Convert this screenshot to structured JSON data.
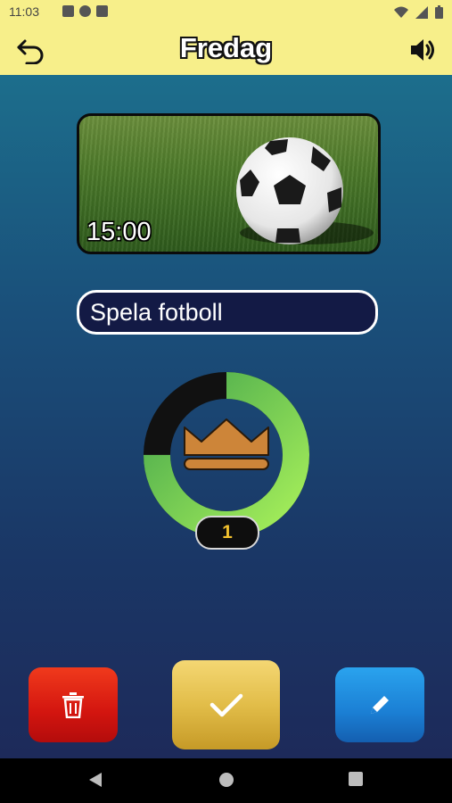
{
  "status_bar": {
    "time": "11:03",
    "left_icons": [
      "notification-a-icon",
      "notification-p-icon",
      "sd-card-icon"
    ],
    "right_icons": [
      "wifi-icon",
      "cellular-icon",
      "battery-icon"
    ]
  },
  "header": {
    "title": "Fredag",
    "back_icon": "undo-arrow-icon",
    "sound_icon": "speaker-icon",
    "background": "#f7ef8a"
  },
  "activity_card": {
    "image": "soccer-ball-on-grass",
    "time": "15:00",
    "title": "Spela fotboll"
  },
  "progress": {
    "fraction": 0.75,
    "center_icon": "crown-icon",
    "count": "1",
    "colors": {
      "remaining": "#111111",
      "done_start": "#9de84f",
      "done_end": "#4caf50",
      "crown": "#cd8539"
    }
  },
  "actions": {
    "delete_icon": "trash-icon",
    "complete_icon": "checkmark-icon",
    "edit_icon": "pencil-icon",
    "colors": {
      "delete": "#d3150f",
      "complete": "#e2bd49",
      "edit": "#1b7fd4"
    }
  },
  "nav_bar": {
    "items": [
      "back-triangle-icon",
      "home-circle-icon",
      "recents-square-icon"
    ]
  }
}
